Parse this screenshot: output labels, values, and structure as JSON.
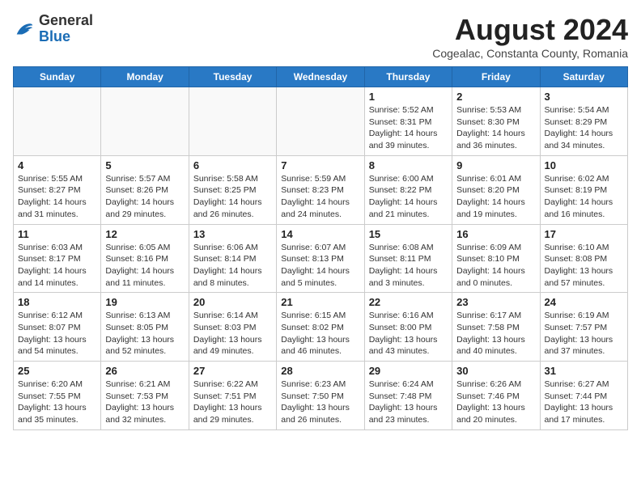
{
  "header": {
    "logo_general": "General",
    "logo_blue": "Blue",
    "month_year": "August 2024",
    "location": "Cogealac, Constanta County, Romania"
  },
  "weekdays": [
    "Sunday",
    "Monday",
    "Tuesday",
    "Wednesday",
    "Thursday",
    "Friday",
    "Saturday"
  ],
  "weeks": [
    [
      {
        "day": "",
        "info": ""
      },
      {
        "day": "",
        "info": ""
      },
      {
        "day": "",
        "info": ""
      },
      {
        "day": "",
        "info": ""
      },
      {
        "day": "1",
        "info": "Sunrise: 5:52 AM\nSunset: 8:31 PM\nDaylight: 14 hours\nand 39 minutes."
      },
      {
        "day": "2",
        "info": "Sunrise: 5:53 AM\nSunset: 8:30 PM\nDaylight: 14 hours\nand 36 minutes."
      },
      {
        "day": "3",
        "info": "Sunrise: 5:54 AM\nSunset: 8:29 PM\nDaylight: 14 hours\nand 34 minutes."
      }
    ],
    [
      {
        "day": "4",
        "info": "Sunrise: 5:55 AM\nSunset: 8:27 PM\nDaylight: 14 hours\nand 31 minutes."
      },
      {
        "day": "5",
        "info": "Sunrise: 5:57 AM\nSunset: 8:26 PM\nDaylight: 14 hours\nand 29 minutes."
      },
      {
        "day": "6",
        "info": "Sunrise: 5:58 AM\nSunset: 8:25 PM\nDaylight: 14 hours\nand 26 minutes."
      },
      {
        "day": "7",
        "info": "Sunrise: 5:59 AM\nSunset: 8:23 PM\nDaylight: 14 hours\nand 24 minutes."
      },
      {
        "day": "8",
        "info": "Sunrise: 6:00 AM\nSunset: 8:22 PM\nDaylight: 14 hours\nand 21 minutes."
      },
      {
        "day": "9",
        "info": "Sunrise: 6:01 AM\nSunset: 8:20 PM\nDaylight: 14 hours\nand 19 minutes."
      },
      {
        "day": "10",
        "info": "Sunrise: 6:02 AM\nSunset: 8:19 PM\nDaylight: 14 hours\nand 16 minutes."
      }
    ],
    [
      {
        "day": "11",
        "info": "Sunrise: 6:03 AM\nSunset: 8:17 PM\nDaylight: 14 hours\nand 14 minutes."
      },
      {
        "day": "12",
        "info": "Sunrise: 6:05 AM\nSunset: 8:16 PM\nDaylight: 14 hours\nand 11 minutes."
      },
      {
        "day": "13",
        "info": "Sunrise: 6:06 AM\nSunset: 8:14 PM\nDaylight: 14 hours\nand 8 minutes."
      },
      {
        "day": "14",
        "info": "Sunrise: 6:07 AM\nSunset: 8:13 PM\nDaylight: 14 hours\nand 5 minutes."
      },
      {
        "day": "15",
        "info": "Sunrise: 6:08 AM\nSunset: 8:11 PM\nDaylight: 14 hours\nand 3 minutes."
      },
      {
        "day": "16",
        "info": "Sunrise: 6:09 AM\nSunset: 8:10 PM\nDaylight: 14 hours\nand 0 minutes."
      },
      {
        "day": "17",
        "info": "Sunrise: 6:10 AM\nSunset: 8:08 PM\nDaylight: 13 hours\nand 57 minutes."
      }
    ],
    [
      {
        "day": "18",
        "info": "Sunrise: 6:12 AM\nSunset: 8:07 PM\nDaylight: 13 hours\nand 54 minutes."
      },
      {
        "day": "19",
        "info": "Sunrise: 6:13 AM\nSunset: 8:05 PM\nDaylight: 13 hours\nand 52 minutes."
      },
      {
        "day": "20",
        "info": "Sunrise: 6:14 AM\nSunset: 8:03 PM\nDaylight: 13 hours\nand 49 minutes."
      },
      {
        "day": "21",
        "info": "Sunrise: 6:15 AM\nSunset: 8:02 PM\nDaylight: 13 hours\nand 46 minutes."
      },
      {
        "day": "22",
        "info": "Sunrise: 6:16 AM\nSunset: 8:00 PM\nDaylight: 13 hours\nand 43 minutes."
      },
      {
        "day": "23",
        "info": "Sunrise: 6:17 AM\nSunset: 7:58 PM\nDaylight: 13 hours\nand 40 minutes."
      },
      {
        "day": "24",
        "info": "Sunrise: 6:19 AM\nSunset: 7:57 PM\nDaylight: 13 hours\nand 37 minutes."
      }
    ],
    [
      {
        "day": "25",
        "info": "Sunrise: 6:20 AM\nSunset: 7:55 PM\nDaylight: 13 hours\nand 35 minutes."
      },
      {
        "day": "26",
        "info": "Sunrise: 6:21 AM\nSunset: 7:53 PM\nDaylight: 13 hours\nand 32 minutes."
      },
      {
        "day": "27",
        "info": "Sunrise: 6:22 AM\nSunset: 7:51 PM\nDaylight: 13 hours\nand 29 minutes."
      },
      {
        "day": "28",
        "info": "Sunrise: 6:23 AM\nSunset: 7:50 PM\nDaylight: 13 hours\nand 26 minutes."
      },
      {
        "day": "29",
        "info": "Sunrise: 6:24 AM\nSunset: 7:48 PM\nDaylight: 13 hours\nand 23 minutes."
      },
      {
        "day": "30",
        "info": "Sunrise: 6:26 AM\nSunset: 7:46 PM\nDaylight: 13 hours\nand 20 minutes."
      },
      {
        "day": "31",
        "info": "Sunrise: 6:27 AM\nSunset: 7:44 PM\nDaylight: 13 hours\nand 17 minutes."
      }
    ]
  ]
}
